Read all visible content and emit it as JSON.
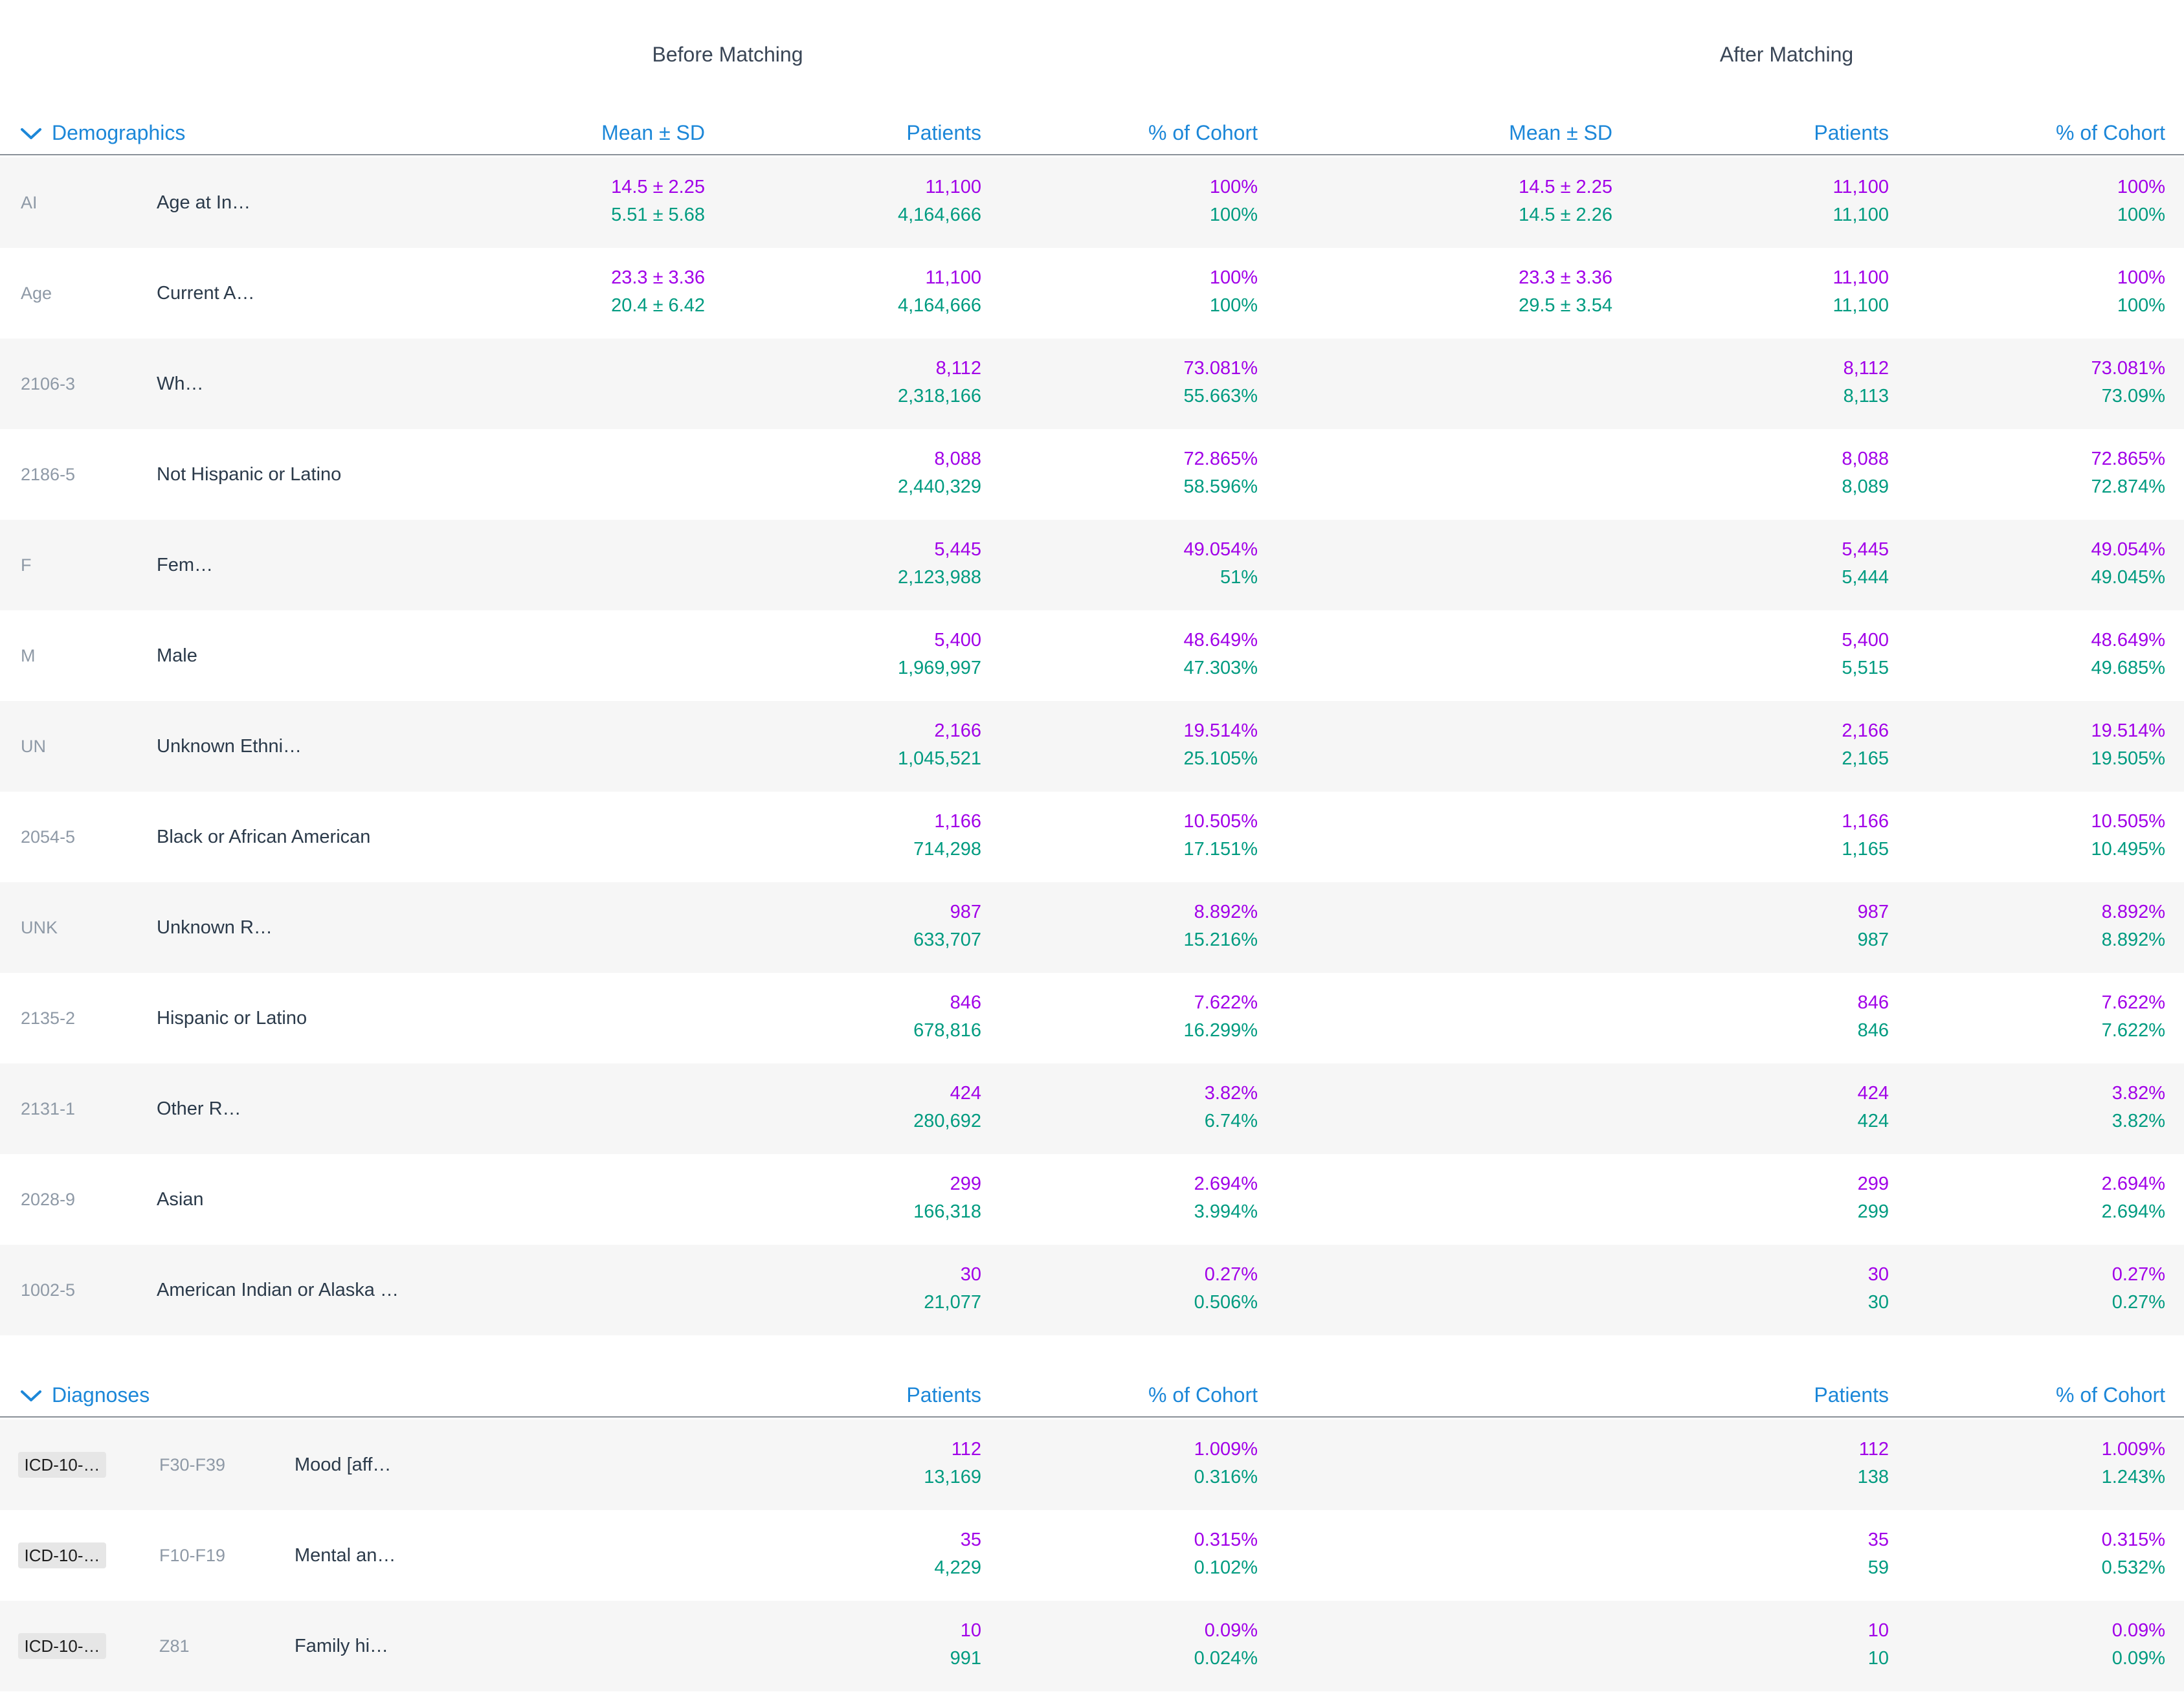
{
  "groups": {
    "before": "Before Matching",
    "after": "After Matching"
  },
  "demographics": {
    "title": "Demographics",
    "headers": {
      "mean": "Mean ± SD",
      "patients": "Patients",
      "cohort": "% of Cohort"
    },
    "rows": [
      {
        "code": "AI",
        "label": "Age at In…",
        "before": {
          "mean": [
            "14.5 ± 2.25",
            "5.51 ± 5.68"
          ],
          "patients": [
            "11,100",
            "4,164,666"
          ],
          "cohort": [
            "100%",
            "100%"
          ]
        },
        "after": {
          "mean": [
            "14.5 ± 2.25",
            "14.5 ± 2.26"
          ],
          "patients": [
            "11,100",
            "11,100"
          ],
          "cohort": [
            "100%",
            "100%"
          ]
        }
      },
      {
        "code": "Age",
        "label": "Current A…",
        "before": {
          "mean": [
            "23.3 ± 3.36",
            "20.4 ± 6.42"
          ],
          "patients": [
            "11,100",
            "4,164,666"
          ],
          "cohort": [
            "100%",
            "100%"
          ]
        },
        "after": {
          "mean": [
            "23.3 ± 3.36",
            "29.5 ± 3.54"
          ],
          "patients": [
            "11,100",
            "11,100"
          ],
          "cohort": [
            "100%",
            "100%"
          ]
        }
      },
      {
        "code": "2106-3",
        "label": "Wh…",
        "before": {
          "mean": [
            "",
            ""
          ],
          "patients": [
            "8,112",
            "2,318,166"
          ],
          "cohort": [
            "73.081%",
            "55.663%"
          ]
        },
        "after": {
          "mean": [
            "",
            ""
          ],
          "patients": [
            "8,112",
            "8,113"
          ],
          "cohort": [
            "73.081%",
            "73.09%"
          ]
        }
      },
      {
        "code": "2186-5",
        "label": "Not Hispanic or Latino",
        "before": {
          "mean": [
            "",
            ""
          ],
          "patients": [
            "8,088",
            "2,440,329"
          ],
          "cohort": [
            "72.865%",
            "58.596%"
          ]
        },
        "after": {
          "mean": [
            "",
            ""
          ],
          "patients": [
            "8,088",
            "8,089"
          ],
          "cohort": [
            "72.865%",
            "72.874%"
          ]
        }
      },
      {
        "code": "F",
        "label": "Fem…",
        "before": {
          "mean": [
            "",
            ""
          ],
          "patients": [
            "5,445",
            "2,123,988"
          ],
          "cohort": [
            "49.054%",
            "51%"
          ]
        },
        "after": {
          "mean": [
            "",
            ""
          ],
          "patients": [
            "5,445",
            "5,444"
          ],
          "cohort": [
            "49.054%",
            "49.045%"
          ]
        }
      },
      {
        "code": "M",
        "label": "Male",
        "before": {
          "mean": [
            "",
            ""
          ],
          "patients": [
            "5,400",
            "1,969,997"
          ],
          "cohort": [
            "48.649%",
            "47.303%"
          ]
        },
        "after": {
          "mean": [
            "",
            ""
          ],
          "patients": [
            "5,400",
            "5,515"
          ],
          "cohort": [
            "48.649%",
            "49.685%"
          ]
        }
      },
      {
        "code": "UN",
        "label": "Unknown Ethni…",
        "before": {
          "mean": [
            "",
            ""
          ],
          "patients": [
            "2,166",
            "1,045,521"
          ],
          "cohort": [
            "19.514%",
            "25.105%"
          ]
        },
        "after": {
          "mean": [
            "",
            ""
          ],
          "patients": [
            "2,166",
            "2,165"
          ],
          "cohort": [
            "19.514%",
            "19.505%"
          ]
        }
      },
      {
        "code": "2054-5",
        "label": "Black or African American",
        "before": {
          "mean": [
            "",
            ""
          ],
          "patients": [
            "1,166",
            "714,298"
          ],
          "cohort": [
            "10.505%",
            "17.151%"
          ]
        },
        "after": {
          "mean": [
            "",
            ""
          ],
          "patients": [
            "1,166",
            "1,165"
          ],
          "cohort": [
            "10.505%",
            "10.495%"
          ]
        }
      },
      {
        "code": "UNK",
        "label": "Unknown R…",
        "before": {
          "mean": [
            "",
            ""
          ],
          "patients": [
            "987",
            "633,707"
          ],
          "cohort": [
            "8.892%",
            "15.216%"
          ]
        },
        "after": {
          "mean": [
            "",
            ""
          ],
          "patients": [
            "987",
            "987"
          ],
          "cohort": [
            "8.892%",
            "8.892%"
          ]
        }
      },
      {
        "code": "2135-2",
        "label": "Hispanic or Latino",
        "before": {
          "mean": [
            "",
            ""
          ],
          "patients": [
            "846",
            "678,816"
          ],
          "cohort": [
            "7.622%",
            "16.299%"
          ]
        },
        "after": {
          "mean": [
            "",
            ""
          ],
          "patients": [
            "846",
            "846"
          ],
          "cohort": [
            "7.622%",
            "7.622%"
          ]
        }
      },
      {
        "code": "2131-1",
        "label": "Other R…",
        "before": {
          "mean": [
            "",
            ""
          ],
          "patients": [
            "424",
            "280,692"
          ],
          "cohort": [
            "3.82%",
            "6.74%"
          ]
        },
        "after": {
          "mean": [
            "",
            ""
          ],
          "patients": [
            "424",
            "424"
          ],
          "cohort": [
            "3.82%",
            "3.82%"
          ]
        }
      },
      {
        "code": "2028-9",
        "label": "Asian",
        "before": {
          "mean": [
            "",
            ""
          ],
          "patients": [
            "299",
            "166,318"
          ],
          "cohort": [
            "2.694%",
            "3.994%"
          ]
        },
        "after": {
          "mean": [
            "",
            ""
          ],
          "patients": [
            "299",
            "299"
          ],
          "cohort": [
            "2.694%",
            "2.694%"
          ]
        }
      },
      {
        "code": "1002-5",
        "label": "American Indian or Alaska …",
        "before": {
          "mean": [
            "",
            ""
          ],
          "patients": [
            "30",
            "21,077"
          ],
          "cohort": [
            "0.27%",
            "0.506%"
          ]
        },
        "after": {
          "mean": [
            "",
            ""
          ],
          "patients": [
            "30",
            "30"
          ],
          "cohort": [
            "0.27%",
            "0.27%"
          ]
        }
      }
    ]
  },
  "diagnoses": {
    "title": "Diagnoses",
    "headers": {
      "patients": "Patients",
      "cohort": "% of Cohort"
    },
    "rows": [
      {
        "tag": "ICD-10-…",
        "code": "F30-F39",
        "label": "Mood [aff…",
        "before": {
          "patients": [
            "112",
            "13,169"
          ],
          "cohort": [
            "1.009%",
            "0.316%"
          ]
        },
        "after": {
          "patients": [
            "112",
            "138"
          ],
          "cohort": [
            "1.009%",
            "1.243%"
          ]
        }
      },
      {
        "tag": "ICD-10-…",
        "code": "F10-F19",
        "label": "Mental an…",
        "before": {
          "patients": [
            "35",
            "4,229"
          ],
          "cohort": [
            "0.315%",
            "0.102%"
          ]
        },
        "after": {
          "patients": [
            "35",
            "59"
          ],
          "cohort": [
            "0.315%",
            "0.532%"
          ]
        }
      },
      {
        "tag": "ICD-10-…",
        "code": "Z81",
        "label": "Family hi…",
        "before": {
          "patients": [
            "10",
            "991"
          ],
          "cohort": [
            "0.09%",
            "0.024%"
          ]
        },
        "after": {
          "patients": [
            "10",
            "10"
          ],
          "cohort": [
            "0.09%",
            "0.09%"
          ]
        }
      }
    ]
  },
  "colors": {
    "accent": "#1c87d8",
    "cohort_primary": "#a100e8",
    "cohort_comparison": "#009b80",
    "row_shade": "#f6f6f6"
  },
  "icons": {
    "section_toggle": "chevron-down-icon"
  }
}
